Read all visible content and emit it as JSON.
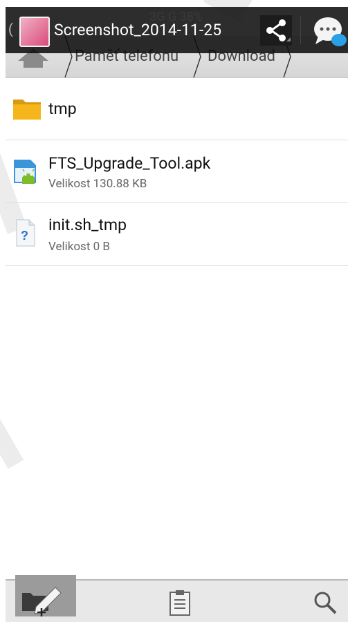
{
  "overlay": {
    "back": "(",
    "title": "Screenshot_2014-11-25",
    "status_text": "3G G 38%"
  },
  "breadcrumb": {
    "items": [
      "Paměť telefonu",
      "Download"
    ]
  },
  "files": [
    {
      "name": "tmp",
      "type": "folder"
    },
    {
      "name": "FTS_Upgrade_Tool.apk",
      "size": "Velikost 130.88 KB",
      "type": "apk"
    },
    {
      "name": "init.sh_tmp",
      "size": "Velikost 0 B",
      "type": "unknown"
    }
  ],
  "colors": {
    "folder": "#f6b51a",
    "android": "#7dbb2a",
    "apk_bg": "#3b95d8",
    "chat": "#2aa0e6",
    "unknown_icon": "#2a6fd6"
  }
}
